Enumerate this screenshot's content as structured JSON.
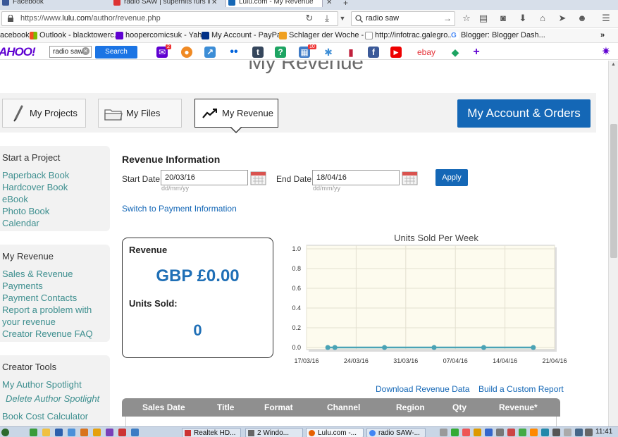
{
  "browser": {
    "tabs": [
      {
        "label": "Facebook"
      },
      {
        "label": "radio SAW | superhits furs in..."
      },
      {
        "label": "Lulu.com - My Revenue"
      }
    ],
    "new_tab": "+",
    "url_prefix": "https://www.",
    "url_domain": "lulu.com",
    "url_path": "/author/revenue.php",
    "search_text": "radio saw"
  },
  "bookmarks": [
    {
      "label": "acebook"
    },
    {
      "label": "Outlook - blacktowerc..."
    },
    {
      "label": "hoopercomicsuk - Yah..."
    },
    {
      "label": "My Account - PayPal"
    },
    {
      "label": "Schlager der Woche - ..."
    },
    {
      "label": "http://infotrac.galegro..."
    },
    {
      "label": "Blogger: Blogger Dash..."
    }
  ],
  "yahoo": {
    "logo": "AHOO!",
    "search_value": "radio saw",
    "search_button": "Search",
    "mail_badge": "2",
    "news_badge": "10"
  },
  "page": {
    "title": "My Revenue",
    "tabs": [
      {
        "label": "My Projects"
      },
      {
        "label": "My Files"
      },
      {
        "label": "My Revenue"
      }
    ],
    "account_button": "My Account & Orders"
  },
  "sidebar": {
    "start": {
      "heading": "Start a Project",
      "links": [
        "Paperback Book",
        "Hardcover Book",
        "eBook",
        "Photo Book",
        "Calendar"
      ]
    },
    "revenue": {
      "heading": "My Revenue",
      "links": [
        "Sales & Revenue",
        "Payments",
        "Payment Contacts",
        "Report a problem with",
        "your revenue",
        "Creator Revenue FAQ"
      ]
    },
    "tools": {
      "heading": "Creator Tools",
      "links": [
        "My Author Spotlight",
        "Delete Author Spotlight",
        "Book Cost Calculator"
      ]
    }
  },
  "revenue_info": {
    "heading": "Revenue Information",
    "start_label": "Start Date:",
    "start_value": "20/03/16",
    "end_label": "End Date:",
    "end_value": "18/04/16",
    "date_hint": "dd/mm/yy",
    "apply": "Apply",
    "switch_link": "Switch to Payment Information"
  },
  "card": {
    "revenue_label": "Revenue",
    "revenue_amount": "GBP £0.00",
    "units_label": "Units Sold:",
    "units_value": "0"
  },
  "chart_data": {
    "type": "line",
    "title": "Units Sold Per Week",
    "xlabel": "",
    "ylabel": "",
    "x_ticks": [
      "17/03/16",
      "24/03/16",
      "31/03/16",
      "07/04/16",
      "14/04/16",
      "21/04/16"
    ],
    "y_ticks": [
      "0.0",
      "0.2",
      "0.4",
      "0.6",
      "0.8",
      "1.0"
    ],
    "ylim": [
      0,
      1
    ],
    "xlim": [
      "17/03/16",
      "21/04/16"
    ],
    "grid": true,
    "series": [
      {
        "x": [
          "20/03/16",
          "21/03/16",
          "28/03/16",
          "04/04/16",
          "11/04/16",
          "18/04/16"
        ],
        "values": [
          0,
          0,
          0,
          0,
          0,
          0
        ]
      }
    ],
    "colors": {
      "line": "#4aa3b5",
      "plot_bg": "#fdfbee",
      "grid": "#e3e0d0"
    }
  },
  "links": {
    "download": "Download Revenue Data",
    "custom_report": "Build a Custom Report"
  },
  "table": {
    "columns": [
      "Sales Date",
      "Title",
      "Format",
      "Channel",
      "Region",
      "Qty",
      "Revenue*"
    ]
  },
  "taskbar": {
    "tasks": [
      {
        "label": "Realtek HD..."
      },
      {
        "label": "2 Windo..."
      },
      {
        "label": "Lulu.com -..."
      },
      {
        "label": "radio SAW-..."
      }
    ],
    "clock": "11:41"
  }
}
